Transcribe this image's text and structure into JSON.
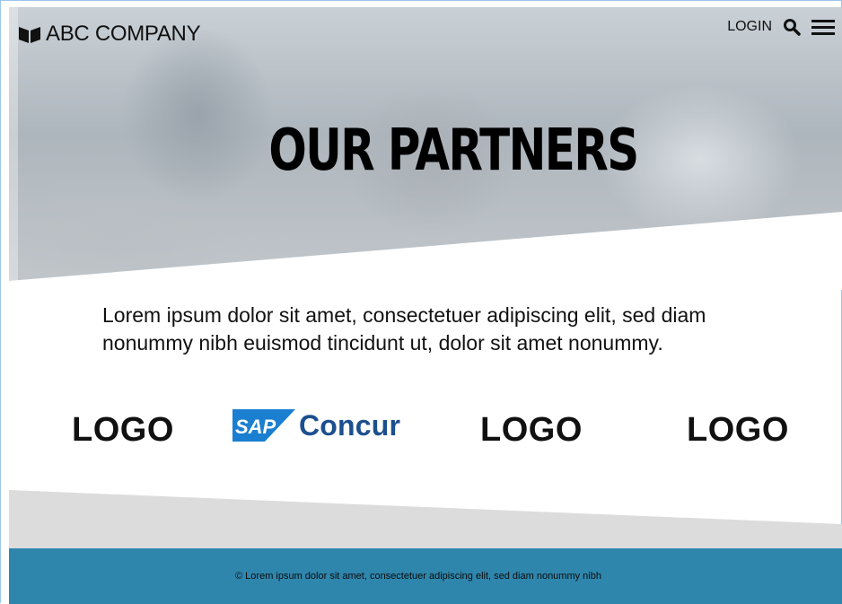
{
  "header": {
    "brand_name": "ABC COMPANY",
    "login_label": "LOGIN",
    "icons": [
      "book-logo-icon",
      "search-icon",
      "menu-icon"
    ]
  },
  "hero": {
    "title": "OUR PARTNERS"
  },
  "intro": {
    "text": "Lorem ipsum dolor sit amet, consectetuer adipiscing elit, sed diam nonummy nibh euismod tincidunt ut, dolor sit amet nonummy."
  },
  "partners": {
    "logo_1": "LOGO",
    "sap_badge": "SAP",
    "concur": "Concur",
    "logo_3": "LOGO",
    "logo_4": "LOGO"
  },
  "footer": {
    "text": "©  Lorem ipsum dolor sit amet, consectetuer adipiscing elit, sed diam nonummy nibh"
  },
  "colors": {
    "footer_bg": "#2f86ad",
    "band_gray": "#dcdcdc",
    "concur_blue": "#1c4f8e",
    "sap_blue": "#1a7fd0",
    "frame_border": "#9cc6ea"
  }
}
